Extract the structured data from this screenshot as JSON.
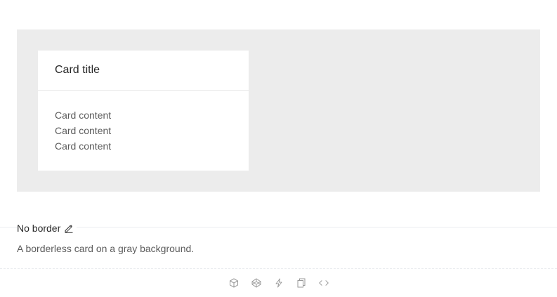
{
  "card": {
    "title": "Card title",
    "content": [
      "Card content",
      "Card content",
      "Card content"
    ]
  },
  "meta": {
    "title": "No border",
    "description": "A borderless card on a gray background."
  },
  "actions": [
    {
      "icon": "codesandbox-icon"
    },
    {
      "icon": "codepen-icon"
    },
    {
      "icon": "thunderbolt-icon"
    },
    {
      "icon": "copy-icon"
    },
    {
      "icon": "code-icon"
    }
  ],
  "colors": {
    "demo_background": "#ececec",
    "card_background": "#ffffff",
    "icon_gray": "#999999"
  }
}
